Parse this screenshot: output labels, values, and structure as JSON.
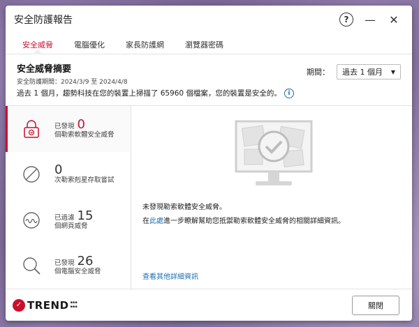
{
  "window": {
    "title": "安全防護報告"
  },
  "tabs": [
    {
      "label": "安全威脅",
      "active": true
    },
    {
      "label": "電腦優化",
      "active": false
    },
    {
      "label": "家長防護網",
      "active": false
    },
    {
      "label": "瀏覽器密碼",
      "active": false
    }
  ],
  "summary": {
    "heading": "安全威脅摘要",
    "range": "安全防護期間：2024/3/9 至 2024/4/8",
    "desc": "過去 1 個月，趨勢科技在您的裝置上掃描了 65960 個檔案，您的裝置是安全的。",
    "period_label": "期間：",
    "period_value": "過去 1 個月"
  },
  "sidebar": [
    {
      "prefix": "已發現",
      "count": "0",
      "label": "個勒索軟體安全威脅",
      "icon": "lock-icon",
      "active": true
    },
    {
      "prefix": "",
      "count": "0",
      "label": "次勒索剋星存取嘗試",
      "icon": "block-icon",
      "active": false
    },
    {
      "prefix": "已過濾",
      "count": "15",
      "label": "個網頁威脅",
      "icon": "wave-icon",
      "active": false
    },
    {
      "prefix": "已發現",
      "count": "26",
      "label": "個電腦安全威脅",
      "icon": "magnifier-icon",
      "active": false
    }
  ],
  "main": {
    "msg1": "未發現勒索軟體安全威脅。",
    "msg2_pre": "在",
    "msg2_link": "此處",
    "msg2_post": "進一步瞭解幫助您抵禦勒索軟體安全威脅的相關詳細資訊。",
    "more_link": "查看其他詳細資訊"
  },
  "footer": {
    "logo_text": "TREND",
    "close_label": "關閉"
  },
  "colors": {
    "accent": "#c8102e",
    "link": "#1a6fb5"
  }
}
